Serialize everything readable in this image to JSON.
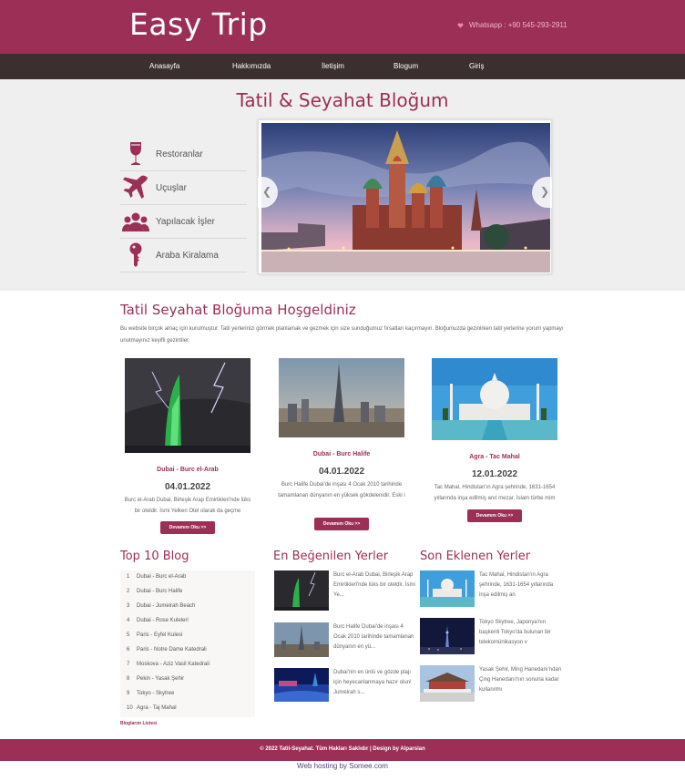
{
  "header": {
    "brand": "Easy Trip",
    "whatsapp_label": "Whatsapp : +90 545-293-2911",
    "whatsapp_icon": "heart-icon"
  },
  "nav": {
    "items": [
      "Anasayfa",
      "Hakkımızda",
      "İletişim",
      "Blogum",
      "Giriş"
    ]
  },
  "hero": {
    "title": "Tatil & Seyahat Bloğum",
    "categories": [
      {
        "label": "Restoranlar",
        "icon": "wine-glass-icon"
      },
      {
        "label": "Uçuşlar",
        "icon": "airplane-icon"
      },
      {
        "label": "Yapılacak İşler",
        "icon": "people-group-icon"
      },
      {
        "label": "Araba Kiralama",
        "icon": "key-icon"
      }
    ],
    "slider": {
      "image": "Saint Basil's Cathedral at dusk",
      "prev_icon": "chevron-left-icon",
      "next_icon": "chevron-right-icon"
    }
  },
  "welcome": {
    "title": "Tatil Seyahat Bloğuma Hoşgeldiniz",
    "text": "Bu website birçok amaç için kurulmuştur. Tatil yerlerinizi görmek planlamak ve gezmek için size sunduğumuz fırsatları kaçırmayın. Bloğumuzda gezinirken tatil yerlerine yorum yapmayı unutmayınız keyifli gezintiler."
  },
  "featured": [
    {
      "title": "Dubai - Burc el-Arab",
      "date": "04.01.2022",
      "description": "Burc el-Arab Dubai, Birleşik Arap Emirlikleri'nde lüks bir oteldir. İsmi Yelken Otel olarak da geçme",
      "button": "Devamını Oku >>"
    },
    {
      "title": "Dubai - Burc Halife",
      "date": "04.01.2022",
      "description": "Burc Halife Dubai'de inşası 4 Ocak 2010 tarihinde tamamlanan dünyanın en yüksek gökdelenidir. Eski i",
      "button": "Devamını Oku >>"
    },
    {
      "title": "Agra - Tac Mahal",
      "date": "12.01.2022",
      "description": "Tac Mahal, Hindistan'ın Agra şehrinde, 1631-1654 yıllarında inşa edilmiş anıt mezar. İslam türbe mim",
      "button": "Devamını Oku >>"
    }
  ],
  "top10": {
    "title": "Top 10 Blog",
    "items": [
      {
        "num": "1",
        "name": "Dubai - Burc el-Arab"
      },
      {
        "num": "2",
        "name": "Dubai - Burc Halife"
      },
      {
        "num": "3",
        "name": "Dubai - Jumeirah Beach"
      },
      {
        "num": "4",
        "name": "Dubai - Rose Kuleleri"
      },
      {
        "num": "5",
        "name": "Paris - Eyfel Kulesi"
      },
      {
        "num": "6",
        "name": "Paris - Notre Dame Katedrali"
      },
      {
        "num": "7",
        "name": "Moskova - Aziz Vasil Katedrali"
      },
      {
        "num": "8",
        "name": "Pekin - Yasak Şehir"
      },
      {
        "num": "9",
        "name": "Tokyo - Skytree"
      },
      {
        "num": "10",
        "name": "Agra - Taj Mahal"
      }
    ],
    "link": "Bloglarım Listesi"
  },
  "liked": {
    "title": "En Beğenilen Yerler",
    "items": [
      {
        "text": "Burc el-Arab Dubai, Birleşik Arap Emirlikleri'nde lüks bir oteldir. İsmi Ye..."
      },
      {
        "text": "Burc Halife Dubai'de inşası 4 Ocak 2010 tarihinde tamamlanan dünyanın en yü..."
      },
      {
        "text": "Dubai'nin en ünlü ve gözde plajı için heyecanlanmaya hazır olun! Jumeirah s..."
      }
    ]
  },
  "recent": {
    "title": "Son Eklenen Yerler",
    "items": [
      {
        "text": "Tac Mahal, Hindistan'ın Agra şehrinde, 1631-1654 yıllarında inşa edilmiş an"
      },
      {
        "text": "Tokyo Skytree, Japonya'nın başkenti Tokyo'da bulunan bir telekomünikasyon v"
      },
      {
        "text": "Yasak Şehir, Ming Hanedanı'ndan Çing Hanedanı'nın sonuna kadar kullanılmı"
      }
    ]
  },
  "footer": {
    "text": "© 2022 Tatil-Seyahat. Tüm Hakları Saklıdır | Design by Alparslan",
    "hosting": "Web hosting by Somee.com"
  },
  "colors": {
    "brand": "#9c2f55",
    "nav_bg": "#3b2f2f",
    "hero_bg": "#efefef"
  }
}
